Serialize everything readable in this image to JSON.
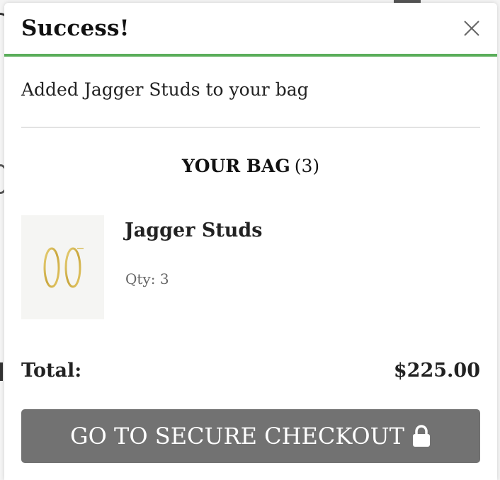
{
  "modal": {
    "title": "Success!",
    "close_icon": "close-icon",
    "accent_color": "#5aad5a",
    "message": "Added Jagger Studs to your bag"
  },
  "bag": {
    "heading": "YOUR BAG",
    "count": "(3)",
    "items": [
      {
        "name": "Jagger Studs",
        "qty_label": "Qty: 3",
        "image_icon": "gold-hoop-earrings-image"
      }
    ]
  },
  "summary": {
    "total_label": "Total:",
    "total_value": "$225.00"
  },
  "checkout": {
    "label": "GO TO SECURE CHECKOUT",
    "icon": "lock-icon",
    "button_color": "#727272"
  }
}
